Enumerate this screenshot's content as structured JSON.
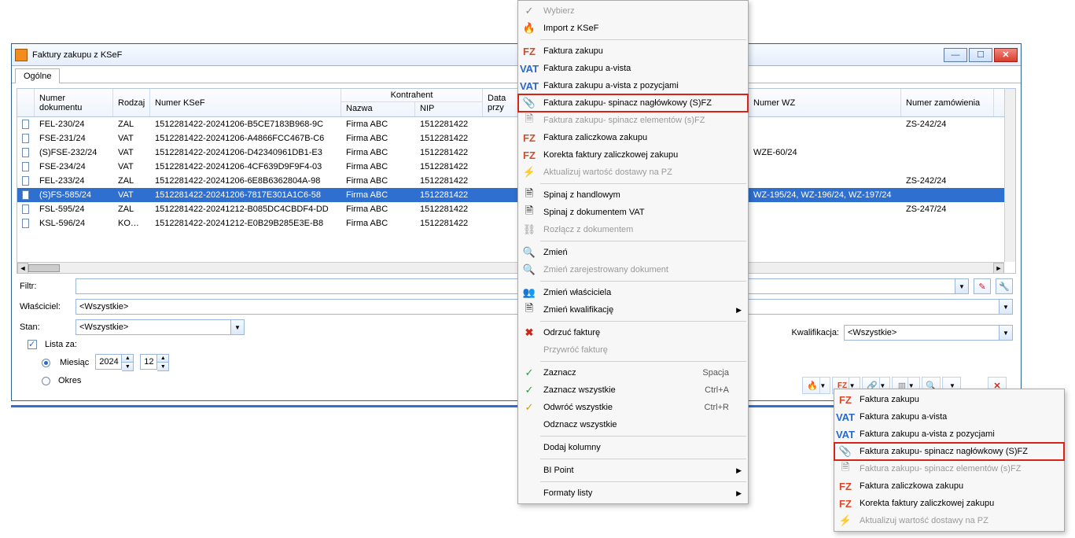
{
  "window": {
    "title": "Faktury zakupu z KSeF"
  },
  "tabs": {
    "main": "Ogólne"
  },
  "grid": {
    "headers": {
      "doc": "Numer dokumentu",
      "type": "Rodzaj",
      "ksef": "Numer KSeF",
      "contractor": "Kontrahent",
      "name": "Nazwa",
      "nip": "NIP",
      "date": "Data przy",
      "wz": "Numer WZ",
      "order": "Numer zamówienia"
    },
    "rows": [
      {
        "doc": "FEL-230/24",
        "type": "ZAL",
        "ksef": "1512281422-20241206-B5CE7183B968-9C",
        "name": "Firma ABC",
        "nip": "1512281422",
        "wz": "",
        "order": "ZS-242/24"
      },
      {
        "doc": "FSE-231/24",
        "type": "VAT",
        "ksef": "1512281422-20241206-A4866FCC467B-C6",
        "name": "Firma ABC",
        "nip": "1512281422",
        "wz": "",
        "order": ""
      },
      {
        "doc": "(S)FSE-232/24",
        "type": "VAT",
        "ksef": "1512281422-20241206-D42340961DB1-E3",
        "name": "Firma ABC",
        "nip": "1512281422",
        "wz": "WZE-60/24",
        "order": ""
      },
      {
        "doc": "FSE-234/24",
        "type": "VAT",
        "ksef": "1512281422-20241206-4CF639D9F9F4-03",
        "name": "Firma ABC",
        "nip": "1512281422",
        "wz": "",
        "order": ""
      },
      {
        "doc": "FEL-233/24",
        "type": "ZAL",
        "ksef": "1512281422-20241206-6E8B6362804A-98",
        "name": "Firma ABC",
        "nip": "1512281422",
        "wz": "",
        "order": "ZS-242/24"
      },
      {
        "doc": "(S)FS-585/24",
        "type": "VAT",
        "ksef": "1512281422-20241206-7817E301A1C6-58",
        "name": "Firma ABC",
        "nip": "1512281422",
        "wz": "WZ-195/24, WZ-196/24, WZ-197/24",
        "order": ""
      },
      {
        "doc": "FSL-595/24",
        "type": "ZAL",
        "ksef": "1512281422-20241212-B085DC4CBDF4-DD",
        "name": "Firma ABC",
        "nip": "1512281422",
        "wz": "",
        "order": "ZS-247/24"
      },
      {
        "doc": "KSL-596/24",
        "type": "KOR_ZA",
        "ksef": "1512281422-20241212-E0B29B285E3E-B8",
        "name": "Firma ABC",
        "nip": "1512281422",
        "wz": "",
        "order": ""
      }
    ],
    "selected_index": 5
  },
  "filters": {
    "filter": "Filtr:",
    "owner": "Właściciel:",
    "owner_value": "<Wszystkie>",
    "state": "Stan:",
    "state_value": "<Wszystkie>",
    "list_for": "Lista za:",
    "month": "Miesiąc",
    "period": "Okres",
    "year": "2024",
    "mon": "12",
    "qualification": "Kwalifikacja:",
    "qualification_value": "<Wszystkie>"
  },
  "contextmenu": {
    "choose": "Wybierz",
    "import_ksef": "Import z KSeF",
    "fz": "Faktura zakupu",
    "fz_avista": "Faktura zakupu a-vista",
    "fz_avista_poz": "Faktura zakupu a-vista z pozycjami",
    "fz_spinacz_nagl": "Faktura zakupu- spinacz nagłówkowy (S)FZ",
    "fz_spinacz_elem": "Faktura zakupu- spinacz elementów (s)FZ",
    "fz_zal": "Faktura zaliczkowa zakupu",
    "fz_zal_kor": "Korekta faktury zaliczkowej zakupu",
    "update_pz": "Aktualizuj wartość dostawy na PZ",
    "join_hand": "Spinaj z handlowym",
    "join_vat": "Spinaj z dokumentem VAT",
    "disconnect": "Rozłącz z dokumentem",
    "change": "Zmień",
    "change_reg": "Zmień zarejestrowany dokument",
    "change_owner": "Zmień właściciela",
    "change_qual": "Zmień kwalifikację",
    "reject": "Odrzuć fakturę",
    "restore": "Przywróć fakturę",
    "select": "Zaznacz",
    "select_all": "Zaznacz wszystkie",
    "invert_all": "Odwróć wszystkie",
    "deselect_all": "Odznacz wszystkie",
    "add_cols": "Dodaj kolumny",
    "bipoint": "BI Point",
    "list_formats": "Formaty listy",
    "shortcut_space": "Spacja",
    "shortcut_ctrla": "Ctrl+A",
    "shortcut_ctrlr": "Ctrl+R"
  }
}
